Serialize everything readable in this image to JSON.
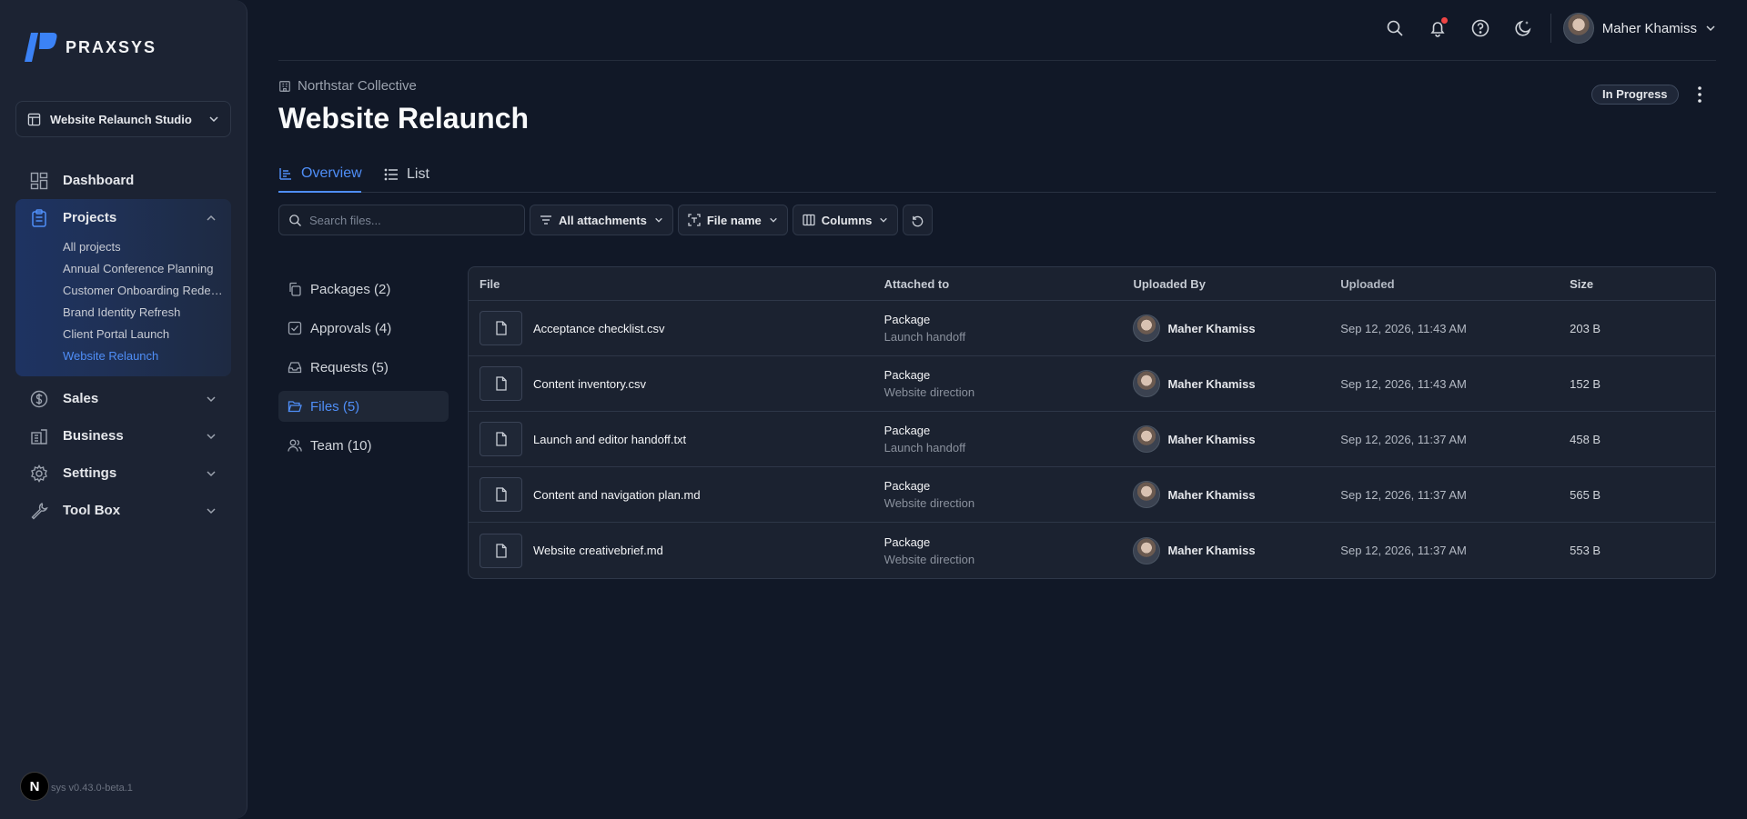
{
  "app": {
    "brand": "PRAXSYS",
    "version": "sys v0.43.0-beta.1",
    "n_badge": "N"
  },
  "workspace": {
    "label": "Website Relaunch Studio"
  },
  "nav": {
    "dashboard": "Dashboard",
    "projects": "Projects",
    "project_items": [
      "All projects",
      "Annual Conference Planning",
      "Customer Onboarding Redesign",
      "Brand Identity Refresh",
      "Client Portal Launch",
      "Website Relaunch"
    ],
    "sales": "Sales",
    "business": "Business",
    "settings": "Settings",
    "toolbox": "Tool Box"
  },
  "topbar": {
    "user_name": "Maher Khamiss"
  },
  "header": {
    "org": "Northstar Collective",
    "title": "Website Relaunch",
    "status": "In Progress"
  },
  "tabs": {
    "overview": "Overview",
    "list": "List"
  },
  "toolbar": {
    "search_placeholder": "Search files...",
    "filter_label": "All attachments",
    "sort_label": "File name",
    "columns_label": "Columns"
  },
  "subnav": {
    "packages": "Packages (2)",
    "approvals": "Approvals (4)",
    "requests": "Requests (5)",
    "files": "Files (5)",
    "team": "Team (10)"
  },
  "table": {
    "headers": {
      "file": "File",
      "attached": "Attached to",
      "by": "Uploaded By",
      "uploaded": "Uploaded",
      "size": "Size"
    },
    "rows": [
      {
        "file": "Acceptance checklist.csv",
        "att_type": "Package",
        "att_sub": "Launch handoff",
        "by": "Maher Khamiss",
        "uploaded": "Sep 12, 2026, 11:43 AM",
        "size": "203 B"
      },
      {
        "file": "Content inventory.csv",
        "att_type": "Package",
        "att_sub": "Website direction",
        "by": "Maher Khamiss",
        "uploaded": "Sep 12, 2026, 11:43 AM",
        "size": "152 B"
      },
      {
        "file": "Launch and editor handoff.txt",
        "att_type": "Package",
        "att_sub": "Launch handoff",
        "by": "Maher Khamiss",
        "uploaded": "Sep 12, 2026, 11:37 AM",
        "size": "458 B"
      },
      {
        "file": "Content and navigation plan.md",
        "att_type": "Package",
        "att_sub": "Website direction",
        "by": "Maher Khamiss",
        "uploaded": "Sep 12, 2026, 11:37 AM",
        "size": "565 B"
      },
      {
        "file": "Website creativebrief.md",
        "att_type": "Package",
        "att_sub": "Website direction",
        "by": "Maher Khamiss",
        "uploaded": "Sep 12, 2026, 11:37 AM",
        "size": "553 B"
      }
    ]
  },
  "colors": {
    "accent": "#4f8ef7",
    "background": "#111827",
    "sidebar": "#1c2333",
    "notification": "#ef4444"
  },
  "icons": [
    "search-icon",
    "bell-icon",
    "help-icon",
    "moon-icon",
    "chevron-down-icon",
    "kebab-icon",
    "file-icon",
    "filter-icon",
    "columns-icon",
    "reset-icon"
  ]
}
